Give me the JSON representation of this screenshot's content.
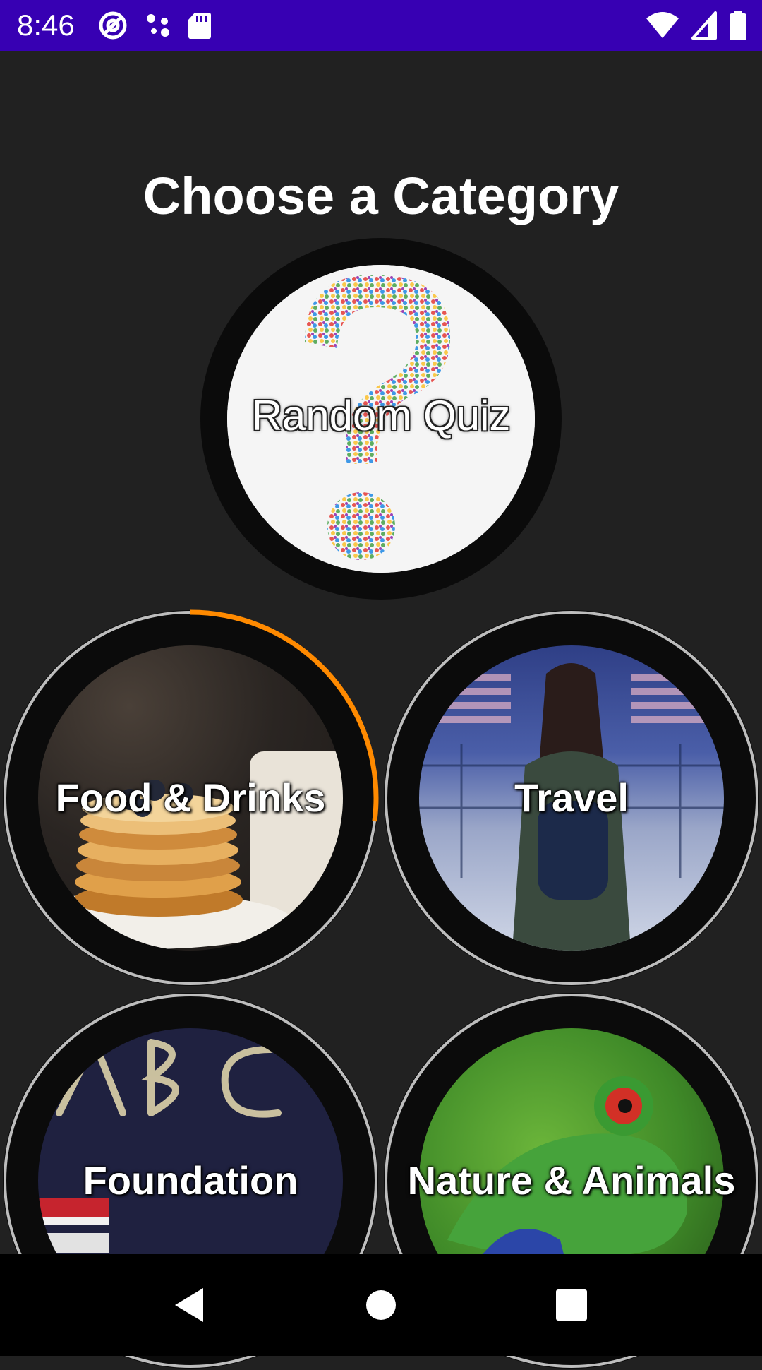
{
  "status_bar": {
    "time": "8:46",
    "left_icons": [
      "at-sign-icon",
      "assistant-dots-icon",
      "sd-card-icon"
    ],
    "right_icons": [
      "wifi-icon",
      "cell-signal-icon",
      "battery-icon"
    ],
    "background_color": "#3700b3"
  },
  "screen": {
    "title": "Choose a Category",
    "background_color": "#212121"
  },
  "categories": [
    {
      "label": "Random Quiz"
    },
    {
      "label": "Food & Drinks",
      "progress_fraction": 0.27,
      "progress_color": "#ff8a00"
    },
    {
      "label": "Travel"
    },
    {
      "label": "Foundation"
    },
    {
      "label": "Nature & Animals"
    }
  ],
  "nav_bar": {
    "buttons": [
      "back-icon",
      "home-icon",
      "recents-icon"
    ]
  }
}
